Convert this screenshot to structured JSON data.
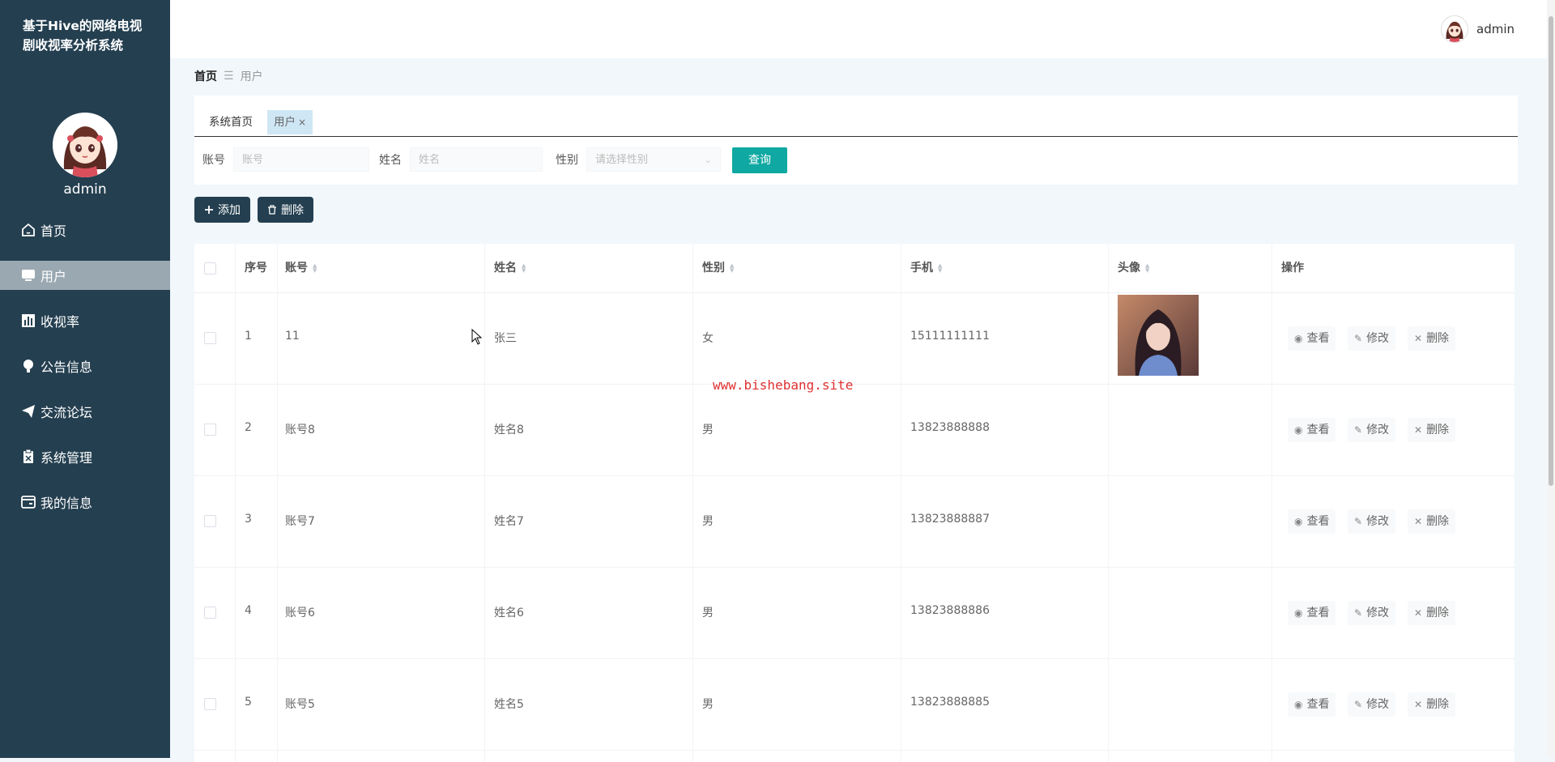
{
  "app": {
    "title": "基于Hive的网络电视剧收视率分析系统"
  },
  "sidebar": {
    "username": "admin",
    "items": [
      {
        "label": "首页",
        "icon": "home-icon"
      },
      {
        "label": "用户",
        "icon": "monitor-icon",
        "active": true
      },
      {
        "label": "收视率",
        "icon": "chart-icon"
      },
      {
        "label": "公告信息",
        "icon": "bulb-icon"
      },
      {
        "label": "交流论坛",
        "icon": "send-icon"
      },
      {
        "label": "系统管理",
        "icon": "clipboard-icon"
      },
      {
        "label": "我的信息",
        "icon": "card-icon"
      }
    ]
  },
  "topbar": {
    "username": "admin"
  },
  "breadcrumb": {
    "home": "首页",
    "separator": "☰",
    "current": "用户"
  },
  "tabs": [
    {
      "label": "系统首页"
    },
    {
      "label": "用户",
      "close": "×"
    }
  ],
  "search": {
    "account_label": "账号",
    "account_placeholder": "账号",
    "name_label": "姓名",
    "name_placeholder": "姓名",
    "gender_label": "性别",
    "gender_placeholder": "请选择性别",
    "query_button": "查询"
  },
  "toolbar": {
    "add_label": "添加",
    "delete_label": "删除"
  },
  "table": {
    "columns": {
      "index": "序号",
      "account": "账号",
      "name": "姓名",
      "gender": "性别",
      "phone": "手机",
      "avatar": "头像",
      "ops": "操作"
    },
    "actions": {
      "view": "查看",
      "edit": "修改",
      "delete": "删除"
    },
    "rows": [
      {
        "index": "1",
        "account": "11",
        "name": "张三",
        "gender": "女",
        "phone": "15111111111",
        "has_photo": true
      },
      {
        "index": "2",
        "account": "账号8",
        "name": "姓名8",
        "gender": "男",
        "phone": "13823888888"
      },
      {
        "index": "3",
        "account": "账号7",
        "name": "姓名7",
        "gender": "男",
        "phone": "13823888887"
      },
      {
        "index": "4",
        "account": "账号6",
        "name": "姓名6",
        "gender": "男",
        "phone": "13823888886"
      },
      {
        "index": "5",
        "account": "账号5",
        "name": "姓名5",
        "gender": "男",
        "phone": "13823888885"
      }
    ]
  },
  "watermark": "www.bishebang.site",
  "colors": {
    "sidebar_bg": "#243f50",
    "accent": "#0fa8a2",
    "watermark": "#e03131"
  }
}
